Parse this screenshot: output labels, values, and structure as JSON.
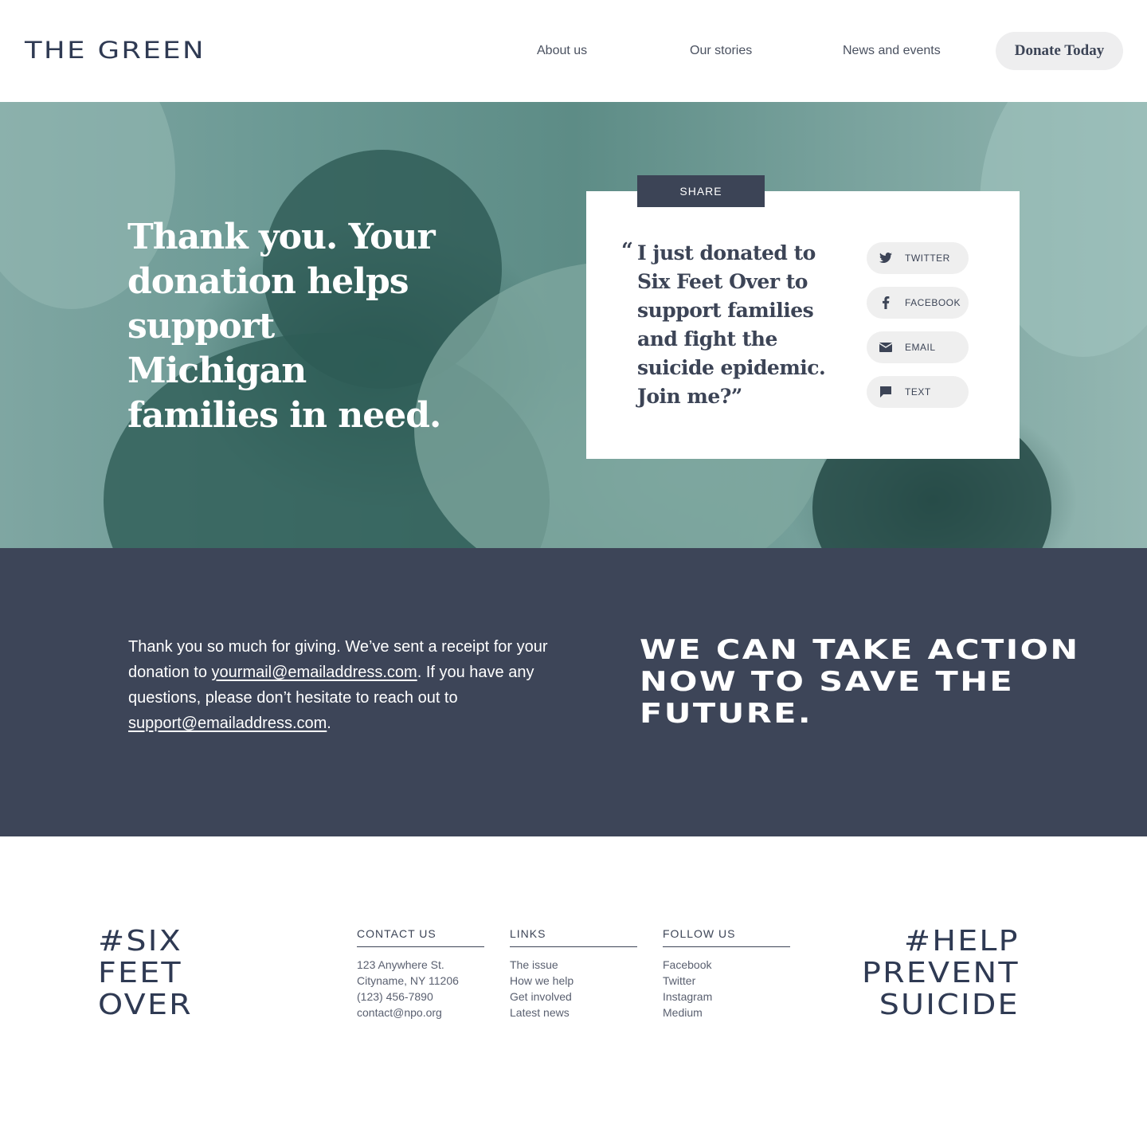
{
  "header": {
    "logo": "THE GREEN",
    "nav": [
      {
        "label": "About us"
      },
      {
        "label": "Our stories"
      },
      {
        "label": "News and events"
      }
    ],
    "donate_label": "Donate Today"
  },
  "hero": {
    "headline": "Thank you. Your donation helps support Michigan families in need.",
    "share": {
      "tab_label": "SHARE",
      "quote_mark": "“",
      "quote": "I just donated to Six Feet Over to support families and fight the suicide epidemic. Join me?”",
      "buttons": [
        {
          "label": "TWITTER",
          "icon": "twitter-icon"
        },
        {
          "label": "FACEBOOK",
          "icon": "facebook-icon"
        },
        {
          "label": "EMAIL",
          "icon": "email-icon"
        },
        {
          "label": "TEXT",
          "icon": "chat-icon"
        }
      ]
    }
  },
  "band": {
    "text_before": "Thank you so much for giving. We’ve sent a receipt for your donation to ",
    "receipt_email": "yourmail@emailaddress.com",
    "text_middle": ". If you have any questions, please don’t hesitate to reach out to ",
    "support_email": "support@emailaddress.com",
    "text_after": ".",
    "slogan": "WE CAN TAKE ACTION NOW TO SAVE THE FUTURE."
  },
  "footer": {
    "tag_left": [
      "#SIX",
      "FEET",
      "OVER"
    ],
    "tag_right": [
      "#HELP",
      "PREVENT",
      "SUICIDE"
    ],
    "contact": {
      "heading": "CONTACT US",
      "items": [
        "123 Anywhere St.",
        "Cityname, NY 11206",
        "(123) 456-7890",
        "contact@npo.org"
      ]
    },
    "links": {
      "heading": "LINKS",
      "items": [
        "The issue",
        "How we help",
        "Get involved",
        "Latest news"
      ]
    },
    "follow": {
      "heading": "FOLLOW US",
      "items": [
        "Facebook",
        "Twitter",
        "Instagram",
        "Medium"
      ]
    }
  },
  "colors": {
    "navy": "#3d4558",
    "teal_photo": "#6b9994",
    "button_gray": "#eeeeef"
  }
}
